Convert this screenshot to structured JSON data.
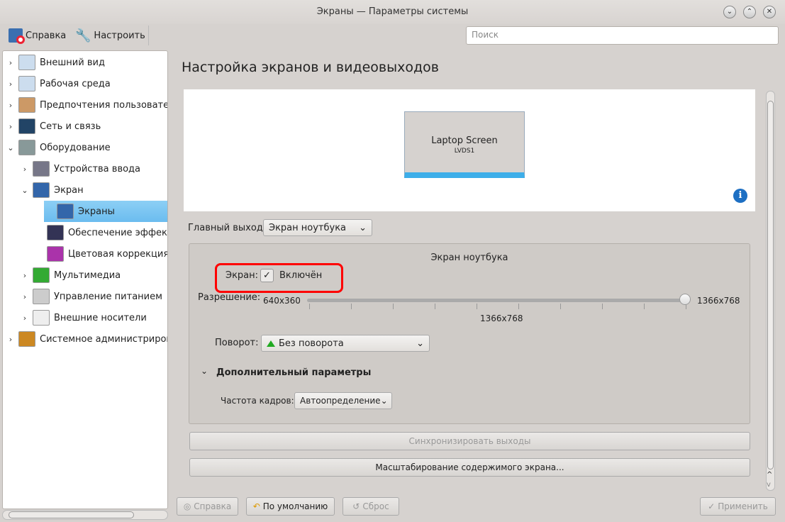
{
  "window": {
    "title": "Экраны — Параметры системы",
    "buttons": [
      "minimize",
      "maximize",
      "close"
    ]
  },
  "toolbar": {
    "help": "Справка",
    "configure": "Настроить",
    "search_placeholder": "Поиск"
  },
  "sidebar": {
    "items": [
      {
        "label": "Внешний вид",
        "level": 0,
        "expand": "collapsed",
        "icon": "appearance-icon"
      },
      {
        "label": "Рабочая среда",
        "level": 0,
        "expand": "collapsed",
        "icon": "workspace-icon"
      },
      {
        "label": "Предпочтения пользователя",
        "level": 0,
        "expand": "collapsed",
        "icon": "user-icon"
      },
      {
        "label": "Сеть и связь",
        "level": 0,
        "expand": "collapsed",
        "icon": "network-icon"
      },
      {
        "label": "Оборудование",
        "level": 0,
        "expand": "expanded",
        "icon": "hardware-icon"
      },
      {
        "label": "Устройства ввода",
        "level": 1,
        "expand": "collapsed",
        "icon": "input-devices-icon"
      },
      {
        "label": "Экран",
        "level": 1,
        "expand": "expanded",
        "icon": "display-icon"
      },
      {
        "label": "Экраны",
        "level": 2,
        "expand": "none",
        "icon": "monitor-icon",
        "selected": true
      },
      {
        "label": "Обеспечение эффектов",
        "level": 2,
        "expand": "none",
        "icon": "effects-icon"
      },
      {
        "label": "Цветовая коррекция",
        "level": 2,
        "expand": "none",
        "icon": "color-correction-icon"
      },
      {
        "label": "Мультимедиа",
        "level": 1,
        "expand": "collapsed",
        "icon": "multimedia-icon"
      },
      {
        "label": "Управление питанием",
        "level": 1,
        "expand": "collapsed",
        "icon": "power-icon"
      },
      {
        "label": "Внешние носители",
        "level": 1,
        "expand": "collapsed",
        "icon": "removable-media-icon"
      },
      {
        "label": "Системное администрирование",
        "level": 0,
        "expand": "collapsed",
        "icon": "system-admin-icon"
      }
    ]
  },
  "main": {
    "heading": "Настройка экранов и видеовыходов",
    "monitor": {
      "name": "Laptop Screen",
      "output": "LVDS1"
    },
    "primary_label": "Главный выход:",
    "primary_value": "Экран ноутбука",
    "group_title": "Экран ноутбука",
    "screen_label": "Экран:",
    "enabled_label": "Включён",
    "enabled": true,
    "resolution_label": "Разрешение:",
    "res_min": "640x360",
    "res_max": "1366x768",
    "res_current": "1366x768",
    "res_fraction": 1.0,
    "rotation_label": "Поворот:",
    "rotation_value": "Без поворота",
    "advanced_label": "Дополнительный параметры",
    "refresh_label": "Частота кадров:",
    "refresh_value": "Автоопределение",
    "sync_button": "Синхронизировать выходы",
    "scale_button": "Масштабирование содержимого экрана..."
  },
  "footer": {
    "help": "Справка",
    "defaults": "По умолчанию",
    "reset": "Сброс",
    "apply": "Применить"
  },
  "colors": {
    "highlight": "#3daee9",
    "annotation": "#ff0000"
  }
}
